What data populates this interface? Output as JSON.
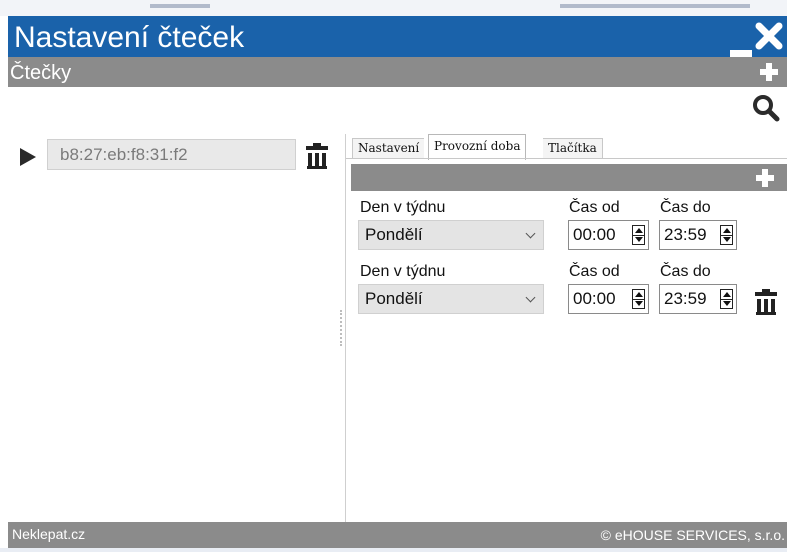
{
  "window": {
    "title": "Nastavení čteček"
  },
  "section": {
    "title": "Čtečky"
  },
  "reader": {
    "id": "b8:27:eb:f8:31:f2"
  },
  "tabs": [
    {
      "label": "Nastavení"
    },
    {
      "label": "Provozní doba"
    },
    {
      "label": "Tlačítka"
    }
  ],
  "active_tab": "Provozní doba",
  "schedule": {
    "rows": [
      {
        "day_label": "Den v týdnu",
        "day_value": "Pondělí",
        "from_label": "Čas od",
        "from_value": "00:00",
        "to_label": "Čas do",
        "to_value": "23:59"
      },
      {
        "day_label": "Den v týdnu",
        "day_value": "Pondělí",
        "from_label": "Čas od",
        "from_value": "00:00",
        "to_label": "Čas do",
        "to_value": "23:59"
      }
    ]
  },
  "footer": {
    "left": "Neklepat.cz",
    "right": "© eHOUSE SERVICES, s.r.o."
  },
  "colors": {
    "titlebar": "#1a62aa",
    "sectionbar": "#8b8b8b",
    "footer": "#8b8b8b"
  },
  "icons": {
    "minimize": "minimize-icon",
    "close": "close-icon",
    "add": "plus-icon",
    "search": "search-icon",
    "expand": "triangle-right-icon",
    "delete": "trash-icon",
    "spinner": "spinner-arrows-icon"
  }
}
